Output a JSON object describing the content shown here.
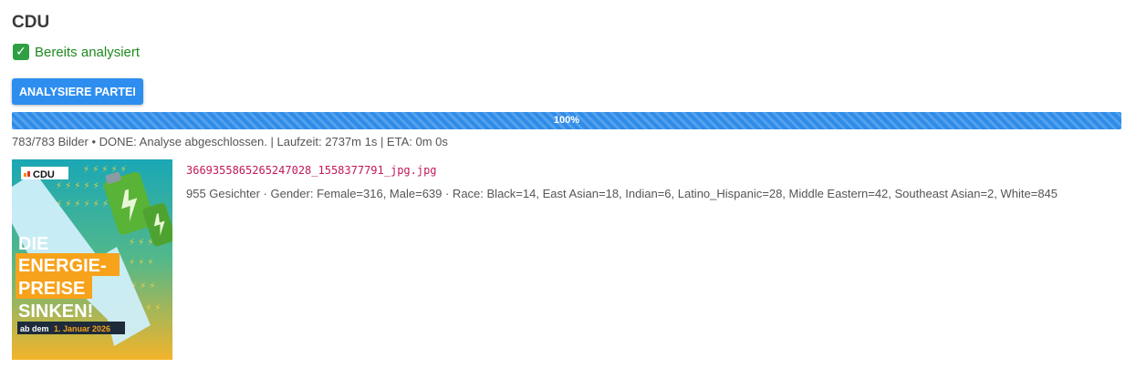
{
  "party": {
    "title": "CDU"
  },
  "status": {
    "icon": "checkmark-icon",
    "check_glyph": "✓",
    "label": "Bereits analysiert",
    "color": "#1f8a1f"
  },
  "analyze_button": {
    "label": "ANALYSIERE PARTEI",
    "color": "#2d8ef0"
  },
  "progress": {
    "value": 1.0,
    "label": "100%",
    "color": "#2f8ce8"
  },
  "run_info": "783/783 Bilder • DONE: Analyse abgeschlossen. | Laufzeit: 2737m 1s | ETA: 0m 0s",
  "results": [
    {
      "filename": "3669355865265247028_1558377791_jpg.jpg",
      "stats": "955 Gesichter · Gender: Female=316, Male=639 · Race: Black=14, East Asian=18, Indian=6, Latino_Hispanic=28, Middle Eastern=42, Southeast Asian=2, White=845",
      "thumbnail": {
        "logo": "CDU",
        "headline_lines": [
          "DIE",
          "ENERGIE-",
          "PREISE",
          "SINKEN!"
        ],
        "date_prefix": "ab dem",
        "date_highlight": "1. Januar 2026"
      }
    }
  ]
}
